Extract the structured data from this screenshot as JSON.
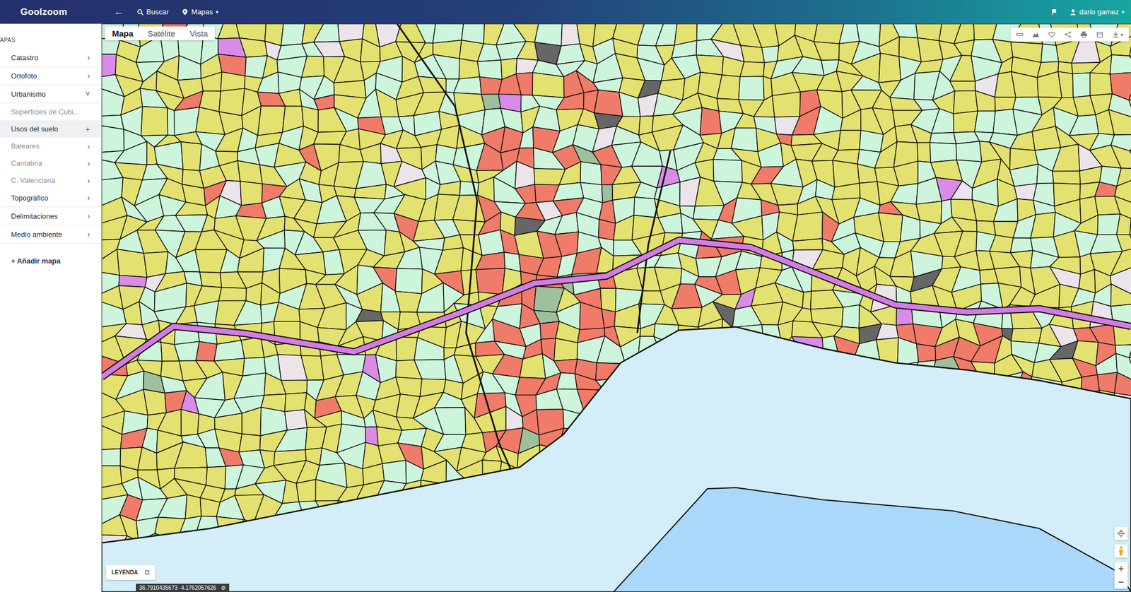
{
  "app": {
    "logo": "Goolzoom"
  },
  "topbar": {
    "back": "←",
    "search": "Buscar",
    "maps": "Mapas",
    "maps_caret": "▾",
    "user": "dario gamez",
    "user_caret": "▾"
  },
  "sidebar": {
    "heading": "APAS",
    "items": [
      {
        "label": "Catastro",
        "marker": "›",
        "kind": "group",
        "expanded": false,
        "selected": false,
        "dimmed": false
      },
      {
        "label": "Ortofoto",
        "marker": "›",
        "kind": "group",
        "expanded": false,
        "selected": false,
        "dimmed": false
      },
      {
        "label": "Urbanismo",
        "marker": "˅",
        "kind": "group",
        "expanded": true,
        "selected": false,
        "dimmed": false
      },
      {
        "label": "Superficies de Cubi...",
        "marker": "",
        "kind": "sub",
        "expanded": false,
        "selected": false,
        "dimmed": true
      },
      {
        "label": "Usos del suelo",
        "marker": "+",
        "kind": "sub",
        "expanded": false,
        "selected": true,
        "dimmed": false
      },
      {
        "label": "Baleares",
        "marker": "›",
        "kind": "sub",
        "expanded": false,
        "selected": false,
        "dimmed": true
      },
      {
        "label": "Cantabria",
        "marker": "›",
        "kind": "sub",
        "expanded": false,
        "selected": false,
        "dimmed": true
      },
      {
        "label": "C. Valenciana",
        "marker": "›",
        "kind": "sub",
        "expanded": false,
        "selected": false,
        "dimmed": true
      },
      {
        "label": "Topográfico",
        "marker": "›",
        "kind": "group",
        "expanded": false,
        "selected": false,
        "dimmed": false
      },
      {
        "label": "Delimitaciones",
        "marker": "›",
        "kind": "group",
        "expanded": false,
        "selected": false,
        "dimmed": false
      },
      {
        "label": "Medio ambiente",
        "marker": "›",
        "kind": "group",
        "expanded": false,
        "selected": false,
        "dimmed": false
      }
    ],
    "add": "+ Añadir mapa"
  },
  "map_tabs": [
    {
      "label": "Mapa",
      "selected": true
    },
    {
      "label": "Satélite",
      "selected": false
    },
    {
      "label": "Vista",
      "selected": false
    }
  ],
  "tools_caret": "▾",
  "zoom": {
    "in": "+",
    "out": "−"
  },
  "legend": {
    "label": "LEYENDA"
  },
  "coordinates": "36.7910435673 -4.1762057626"
}
